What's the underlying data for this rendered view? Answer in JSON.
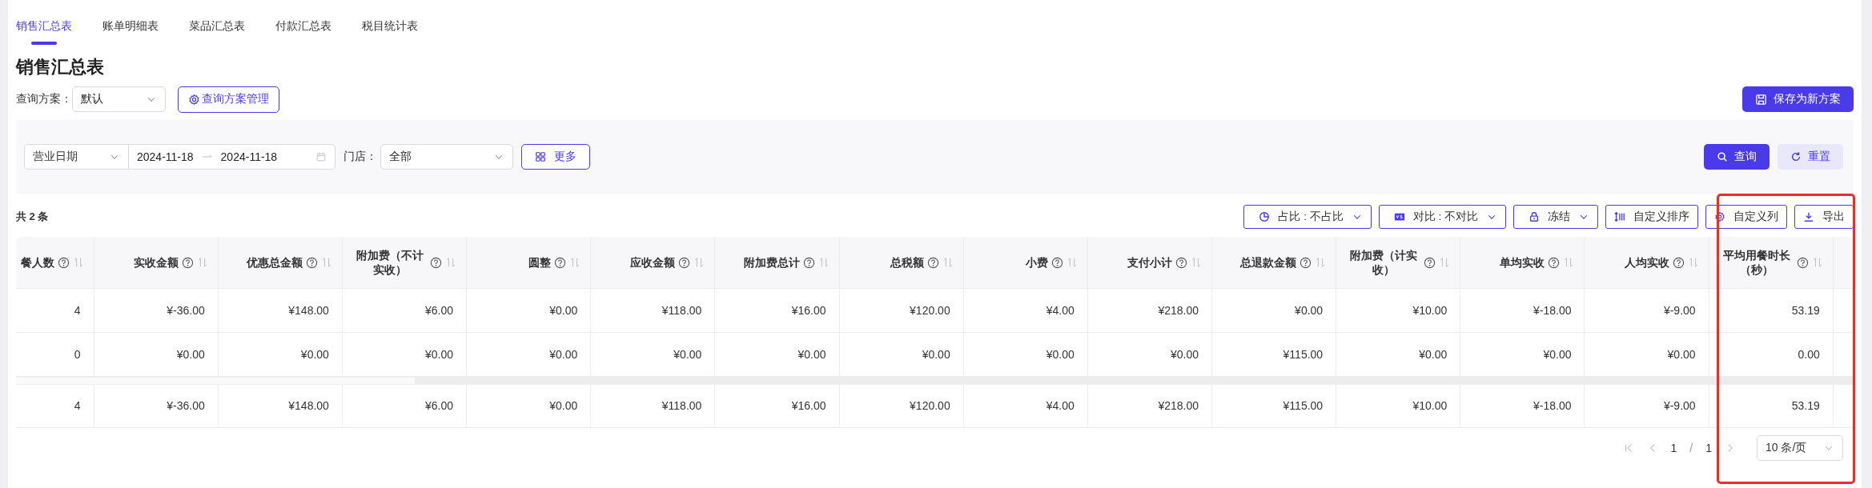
{
  "tabs": [
    {
      "label": "销售汇总表",
      "selected": true
    },
    {
      "label": "账单明细表",
      "selected": false
    },
    {
      "label": "菜品汇总表",
      "selected": false
    },
    {
      "label": "付款汇总表",
      "selected": false
    },
    {
      "label": "税目统计表",
      "selected": false
    }
  ],
  "title": "销售汇总表",
  "scheme": {
    "label": "查询方案：",
    "value": "默认",
    "manage_button": "查询方案管理"
  },
  "save_button": "保存为新方案",
  "filters": {
    "date_type": "营业日期",
    "start_date": "2024-11-18",
    "end_date": "2024-11-18",
    "store_label": "门店：",
    "store": "全部",
    "more_button": "更多",
    "query_button": "查询",
    "reset_button": "重置"
  },
  "total": "共 2 条",
  "toolbar": [
    {
      "kind": "ratio",
      "label": "占比 : 不占比",
      "dropdown": true
    },
    {
      "kind": "compare",
      "label": "对比 : 不对比",
      "dropdown": true
    },
    {
      "kind": "freeze",
      "label": "冻结",
      "dropdown": true
    },
    {
      "kind": "sort",
      "label": "自定义排序",
      "dropdown": false
    },
    {
      "kind": "columns",
      "label": "自定义列",
      "dropdown": false
    },
    {
      "kind": "export",
      "label": "导出",
      "dropdown": false
    }
  ],
  "table": {
    "columns": [
      {
        "label": "餐人数",
        "highlighted": false
      },
      {
        "label": "实收金额",
        "highlighted": false
      },
      {
        "label": "优惠总金额",
        "highlighted": false
      },
      {
        "label": "附加费（不计实收）",
        "highlighted": false
      },
      {
        "label": "圆整",
        "highlighted": false
      },
      {
        "label": "应收金额",
        "highlighted": false
      },
      {
        "label": "附加费总计",
        "highlighted": false
      },
      {
        "label": "总税额",
        "highlighted": false
      },
      {
        "label": "小费",
        "highlighted": false
      },
      {
        "label": "支付小计",
        "highlighted": false
      },
      {
        "label": "总退款金额",
        "highlighted": false
      },
      {
        "label": "附加费（计实收）",
        "highlighted": false
      },
      {
        "label": "单均实收",
        "highlighted": false
      },
      {
        "label": "人均实收",
        "highlighted": false
      },
      {
        "label": "平均用餐时长（秒）",
        "highlighted": true
      }
    ],
    "rows": [
      [
        "4",
        "¥-36.00",
        "¥148.00",
        "¥6.00",
        "¥0.00",
        "¥118.00",
        "¥16.00",
        "¥120.00",
        "¥4.00",
        "¥218.00",
        "¥0.00",
        "¥10.00",
        "¥-18.00",
        "¥-9.00",
        "53.19"
      ],
      [
        "0",
        "¥0.00",
        "¥0.00",
        "¥0.00",
        "¥0.00",
        "¥0.00",
        "¥0.00",
        "¥0.00",
        "¥0.00",
        "¥0.00",
        "¥115.00",
        "¥0.00",
        "¥0.00",
        "¥0.00",
        "0.00"
      ]
    ],
    "summary": [
      "4",
      "¥-36.00",
      "¥148.00",
      "¥6.00",
      "¥0.00",
      "¥118.00",
      "¥16.00",
      "¥120.00",
      "¥4.00",
      "¥218.00",
      "¥115.00",
      "¥10.00",
      "¥-18.00",
      "¥-9.00",
      "53.19"
    ]
  },
  "pagination": {
    "current": "1",
    "separator": "/",
    "total": "1",
    "page_size": "10 条/页"
  }
}
